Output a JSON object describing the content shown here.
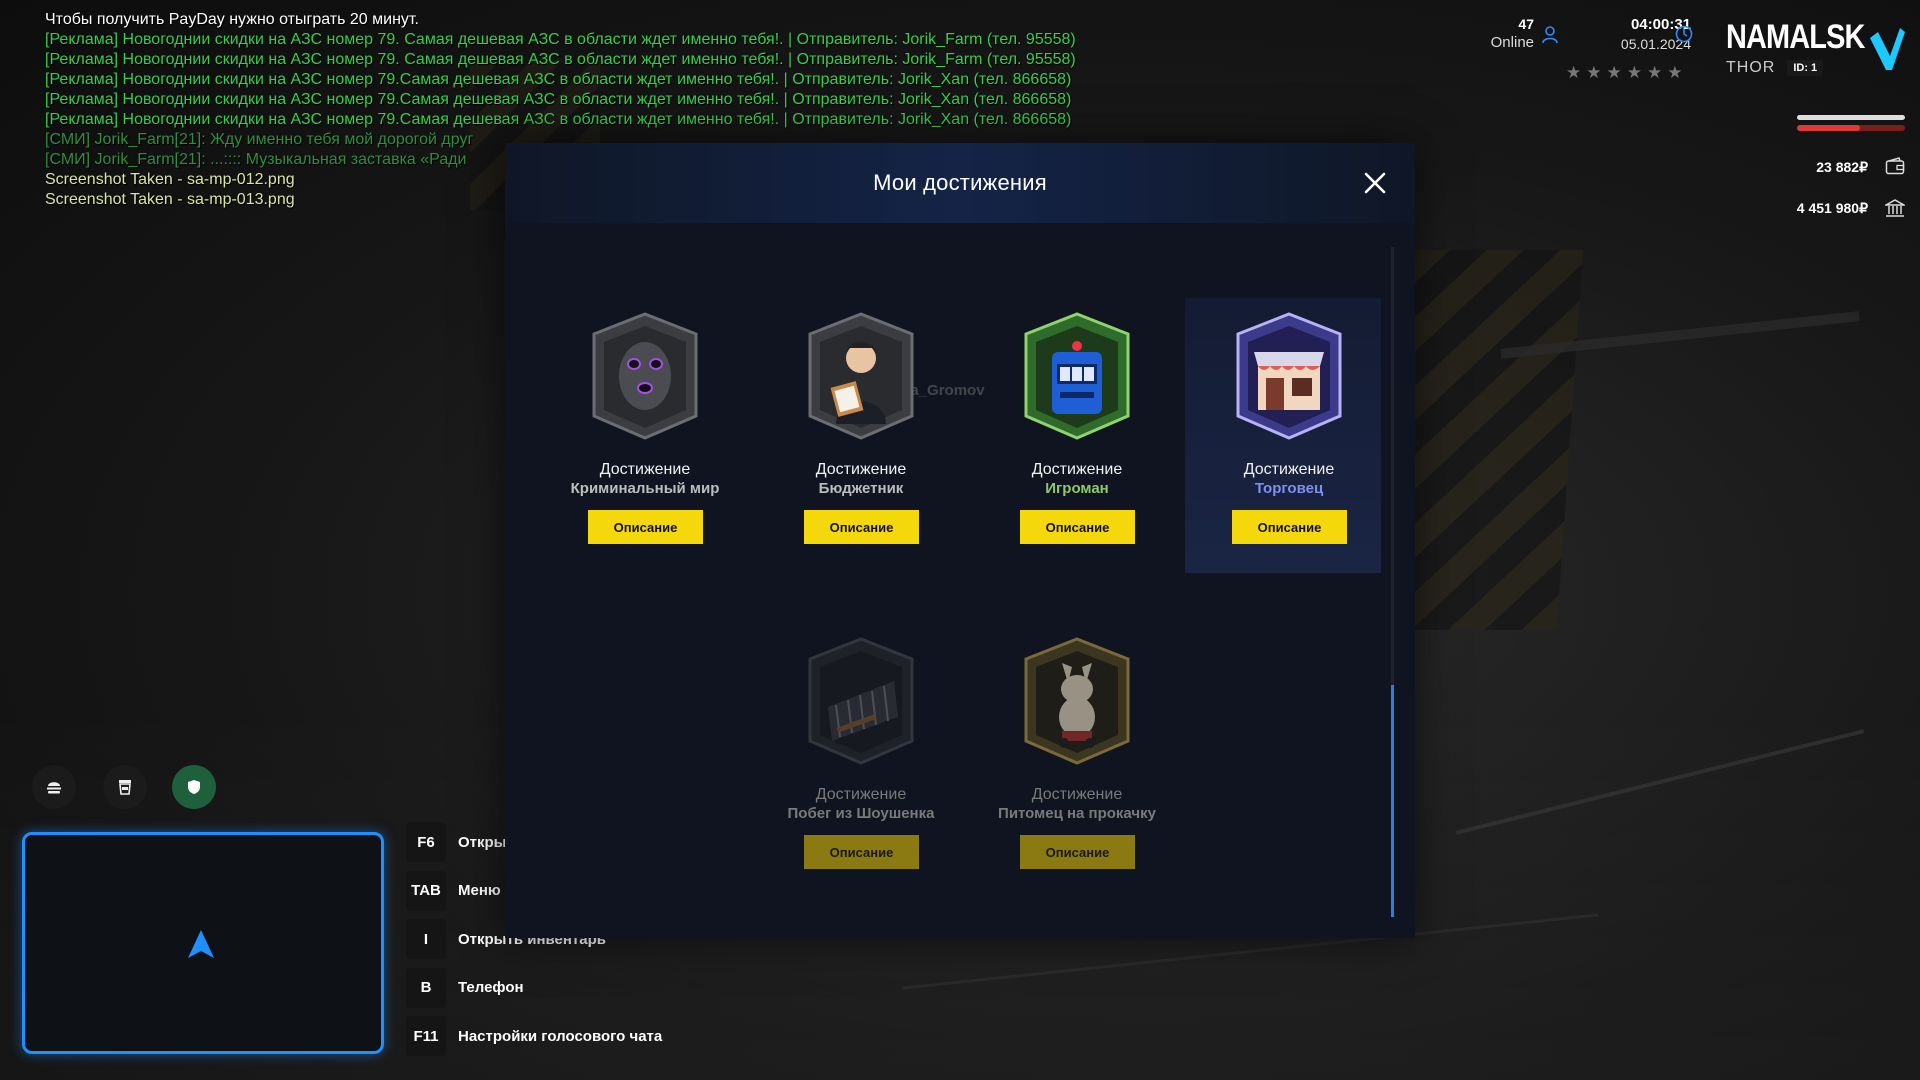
{
  "chat": [
    {
      "text": "Чтобы получить PayDay нужно отыграть 20 минут.",
      "color": "white"
    },
    {
      "text": "[Реклама] Новогоднии скидки на АЗС номер 79. Самая дешевая АЗС в области ждет именно тебя!.  | Отправитель: Jorik_Farm (тел. 95558)",
      "color": "green"
    },
    {
      "text": "[Реклама] Новогоднии скидки на АЗС номер 79. Самая дешевая АЗС в области ждет именно тебя!.  | Отправитель: Jorik_Farm (тел. 95558)",
      "color": "green"
    },
    {
      "text": "[Реклама] Новогоднии скидки на АЗС номер 79.Самая дешевая АЗС в области ждет именно тебя!.  | Отправитель: Jorik_Xan (тел. 866658)",
      "color": "green"
    },
    {
      "text": "[Реклама] Новогоднии скидки на АЗС номер 79.Самая дешевая АЗС в области ждет именно тебя!.  | Отправитель: Jorik_Xan (тел. 866658)",
      "color": "green"
    },
    {
      "text": "[Реклама] Новогоднии скидки на АЗС номер 79.Самая дешевая АЗС в области ждет именно тебя!.  | Отправитель: Jorik_Xan (тел. 866658)",
      "color": "green"
    },
    {
      "text": "[СМИ] Jorik_Farm[21]: Жду именно тебя мой дорогой друг",
      "color": "dgreen"
    },
    {
      "text": "[СМИ] Jorik_Farm[21]: ...:::: Музыкальная заставка «Ради",
      "color": "dgreen"
    },
    {
      "text": "Screenshot Taken - sa-mp-012.png",
      "color": "yellowish"
    },
    {
      "text": "Screenshot Taken - sa-mp-013.png",
      "color": "yellowish"
    }
  ],
  "hud": {
    "online_count": "47",
    "online_label": "Online",
    "time": "04:00:31",
    "date": "05.01.2024",
    "stars_total": 6,
    "brand_name": "NAMALSK",
    "server": "THOR",
    "player_id": "ID: 1",
    "health_fraction": 1.0,
    "armor_fraction": 0.58,
    "cash": "23 882₽",
    "bank": "4 451 980₽",
    "accent_color": "#1ec9ff"
  },
  "keys": [
    {
      "key": "F6",
      "label": "Открыть чат"
    },
    {
      "key": "TAB",
      "label": "Меню"
    },
    {
      "key": "I",
      "label": "Открыть инвентарь"
    },
    {
      "key": "B",
      "label": "Телефон"
    },
    {
      "key": "F11",
      "label": "Настройки голосового чата"
    }
  ],
  "modal": {
    "title": "Мои достижения",
    "watermark": "ma_Gromov",
    "achievements": [
      {
        "label": "Достижение",
        "name": "Криминальный мир",
        "button": "Описание",
        "icon": "mask-icon",
        "locked": false,
        "selected": false,
        "name_color": "gray"
      },
      {
        "label": "Достижение",
        "name": "Бюджетник",
        "button": "Описание",
        "icon": "clerk-icon",
        "locked": false,
        "selected": false,
        "name_color": "gray"
      },
      {
        "label": "Достижение",
        "name": "Игроман",
        "button": "Описание",
        "icon": "slot-machine-icon",
        "locked": false,
        "selected": false,
        "name_color": "green"
      },
      {
        "label": "Достижение",
        "name": "Торговец",
        "button": "Описание",
        "icon": "shop-icon",
        "locked": false,
        "selected": true,
        "name_color": "purple"
      },
      {
        "label": "Достижение",
        "name": "Побег из Шоушенка",
        "button": "Описание",
        "icon": "prison-bars-icon",
        "locked": true,
        "selected": false,
        "name_color": "gray"
      },
      {
        "label": "Достижение",
        "name": "Питомец на прокачку",
        "button": "Описание",
        "icon": "pet-icon",
        "locked": true,
        "selected": false,
        "name_color": "gray"
      }
    ]
  }
}
